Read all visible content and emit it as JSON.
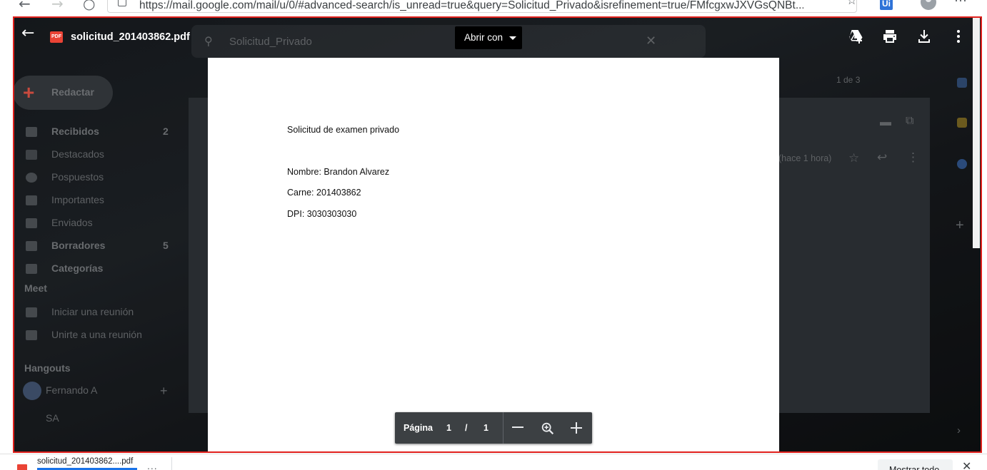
{
  "browser": {
    "url": "https://mail.google.com/mail/u/0/#advanced-search/is_unread=true&query=Solicitud_Privado&isrefinement=true/FMfcgxwJXVGsQNBt...",
    "back_glyph": "←",
    "forward_glyph": "→",
    "reload_glyph": "○",
    "star_glyph": "☆",
    "extension_label": "Ui",
    "more_glyph": "⋯"
  },
  "gmail_background": {
    "search_text": "Solicitud_Privado",
    "compose_label": "Redactar",
    "nav_items": [
      {
        "label": "Recibidos",
        "count": "2",
        "bold": true
      },
      {
        "label": "Destacados",
        "count": ""
      },
      {
        "label": "Pospuestos",
        "count": ""
      },
      {
        "label": "Importantes",
        "count": ""
      },
      {
        "label": "Enviados",
        "count": ""
      },
      {
        "label": "Borradores",
        "count": "5",
        "bold": true
      },
      {
        "label": "Categorías",
        "count": "",
        "bold": true
      }
    ],
    "meet_heading": "Meet",
    "meet_items": [
      "Iniciar una reunión",
      "Unirte a una reunión"
    ],
    "hangouts_heading": "Hangouts",
    "hangouts_user": "Fernando A",
    "hangouts_contact": "SA",
    "pagination": "1 de 3",
    "time_ago": "(hace 1 hora)"
  },
  "viewer": {
    "file_name": "solicitud_201403862.pdf",
    "pdf_badge": "PDF",
    "open_with_label": "Abrir con",
    "actions": [
      "add-to-drive",
      "print",
      "download",
      "more-options"
    ]
  },
  "document": {
    "heading": "Solicitud de examen privado",
    "fields": [
      "Nombre: Brandon Alvarez",
      "Carne: 201403862",
      "DPI: 3030303030"
    ]
  },
  "pager": {
    "label": "Página",
    "current": "1",
    "separator": "/",
    "total": "1"
  },
  "download_shelf": {
    "file_name": "solicitud_201403862....pdf",
    "menu_glyph": "...",
    "show_all_label": "Mostrar todo",
    "close_glyph": "✕"
  },
  "colors": {
    "outline": "#e0201c",
    "pdf_red": "#ea4335",
    "pager_bg": "#3c4043",
    "link_blue": "#1a73e8"
  }
}
